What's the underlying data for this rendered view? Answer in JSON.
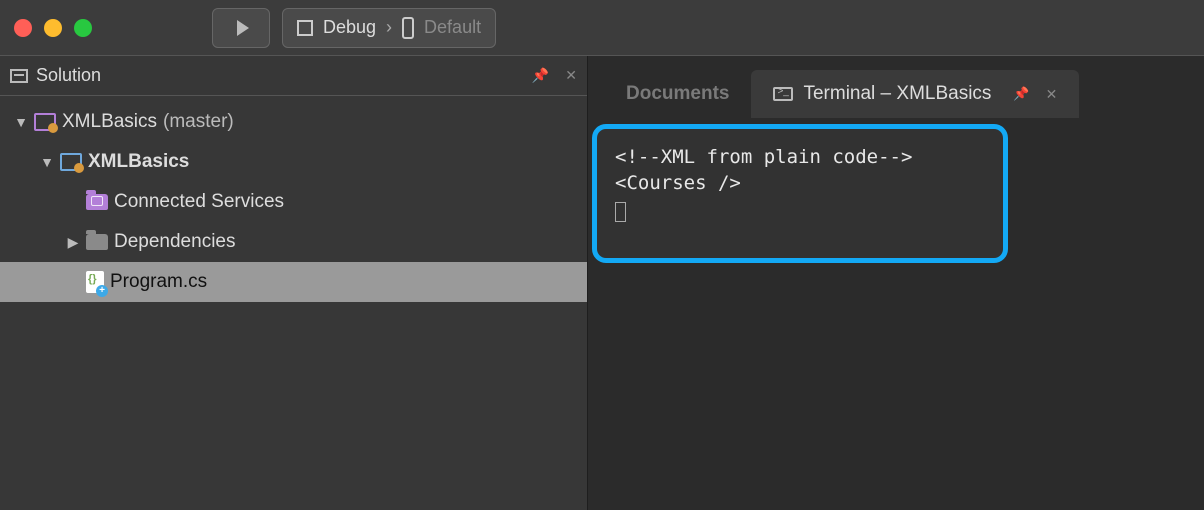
{
  "toolbar": {
    "config_label": "Debug",
    "target_label": "Default"
  },
  "solution_panel": {
    "title": "Solution"
  },
  "tree": {
    "solution_name": "XMLBasics",
    "solution_branch": "(master)",
    "project_name": "XMLBasics",
    "connected_services": "Connected Services",
    "dependencies": "Dependencies",
    "program_file": "Program.cs"
  },
  "tabs": {
    "documents": "Documents",
    "terminal": "Terminal – XMLBasics"
  },
  "terminal": {
    "line1": "<!--XML from plain code-->",
    "line2": "<Courses />"
  }
}
